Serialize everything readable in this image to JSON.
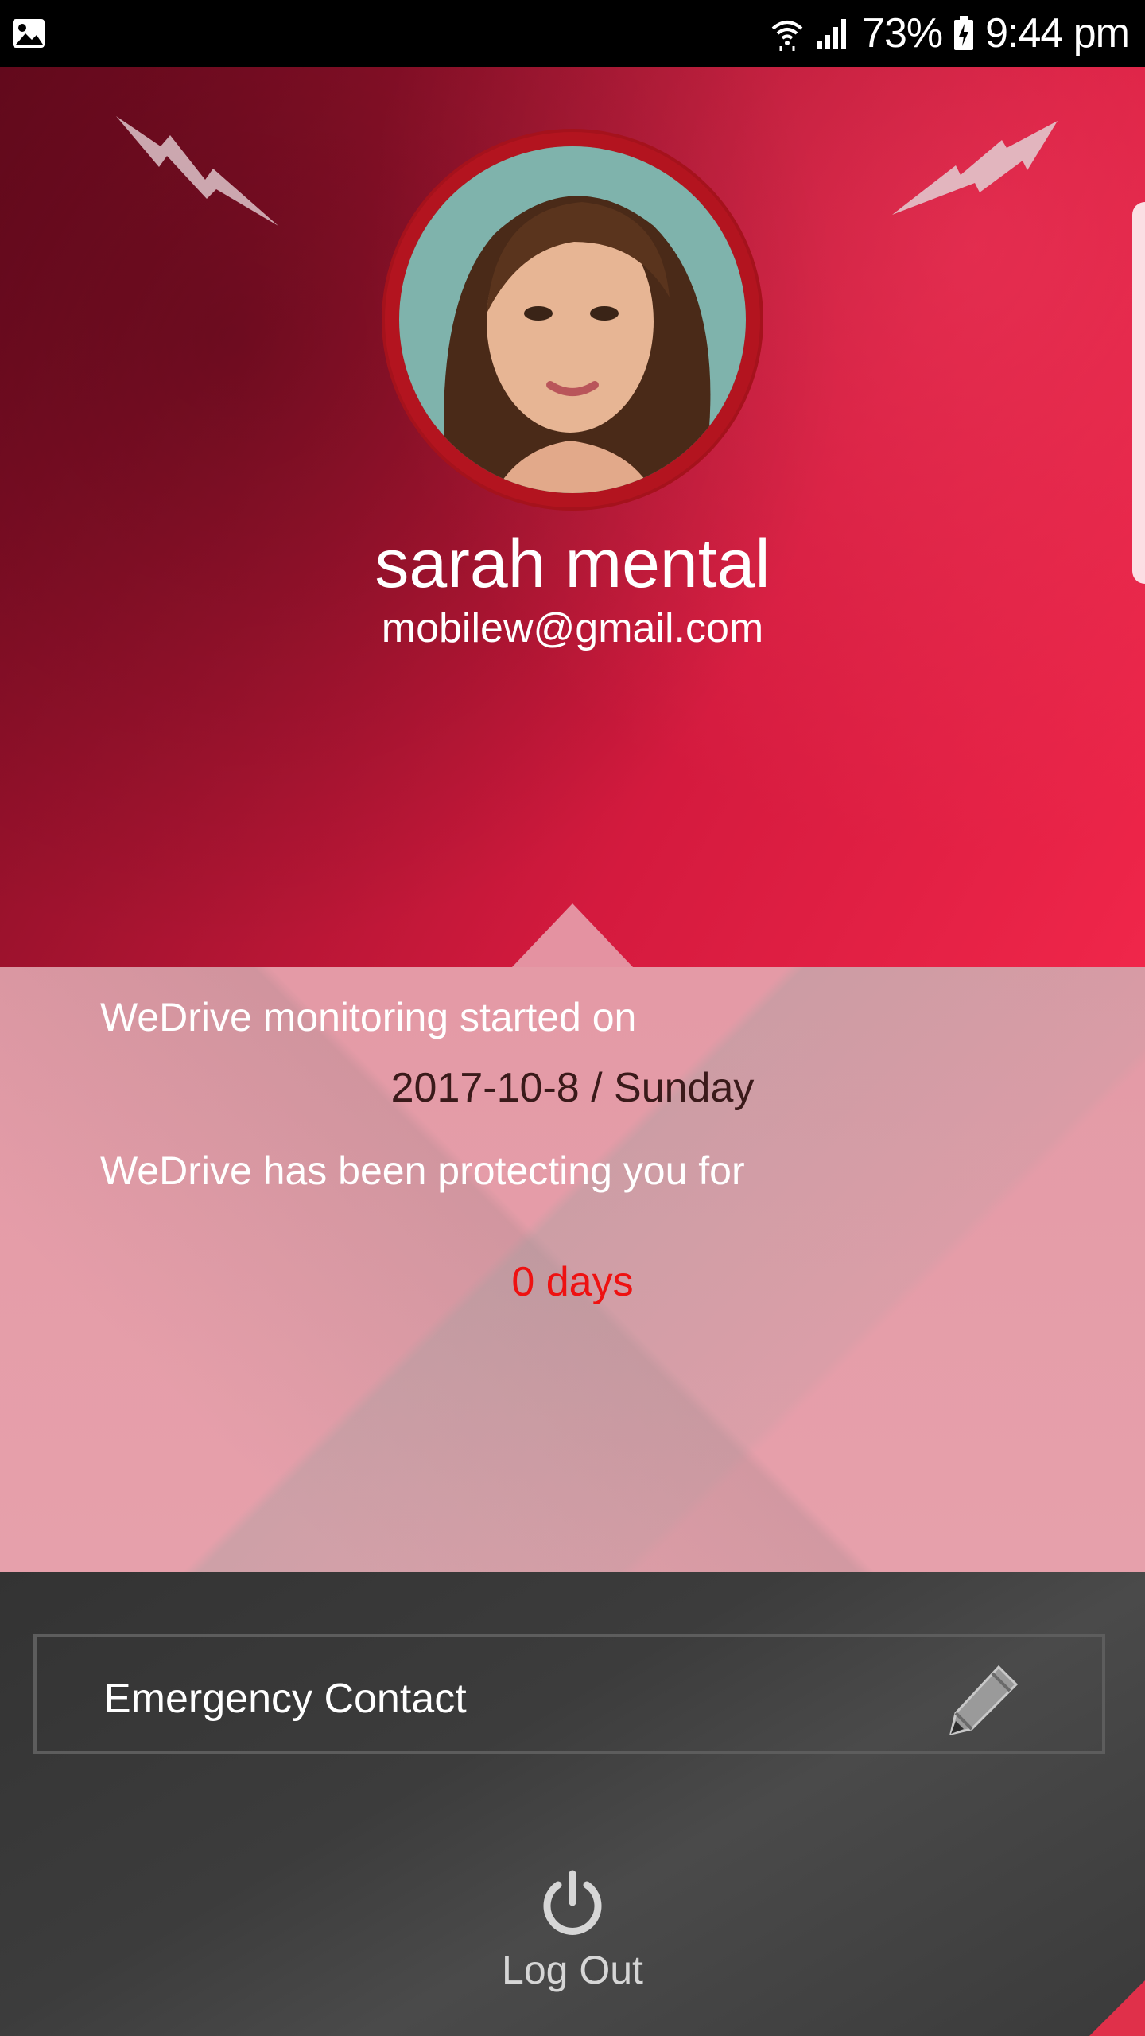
{
  "status_bar": {
    "battery_text": "73%",
    "time": "9:44 pm",
    "icons": [
      "image-icon",
      "wifi-icon",
      "signal-icon",
      "battery-charging-icon"
    ]
  },
  "profile": {
    "name": "sarah mental",
    "email": "mobilew@gmail.com"
  },
  "monitoring": {
    "started_label": "WeDrive monitoring started on",
    "start_date": "2017-10-8 / Sunday",
    "protecting_label": "WeDrive has been protecting you for",
    "days_text": "0 days"
  },
  "actions": {
    "emergency_contact_label": "Emergency Contact",
    "logout_label": "Log Out"
  },
  "colors": {
    "hero_red": "#d41a3e",
    "days_red": "#ee1111",
    "panel_pink": "#e49aa6",
    "bottom_gray": "#3c3c3c"
  }
}
